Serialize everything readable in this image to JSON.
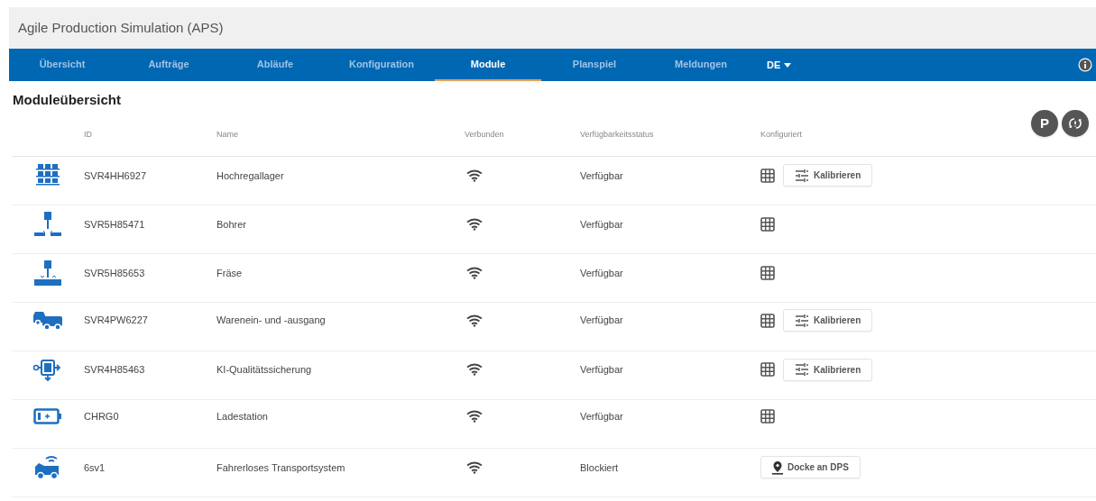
{
  "app_title": "Agile Production Simulation (APS)",
  "tabs": [
    {
      "label": "Übersicht",
      "selected": false
    },
    {
      "label": "Aufträge",
      "selected": false
    },
    {
      "label": "Abläufe",
      "selected": false
    },
    {
      "label": "Konfiguration",
      "selected": false
    },
    {
      "label": "Module",
      "selected": true
    },
    {
      "label": "Planspiel",
      "selected": false
    },
    {
      "label": "Meldungen",
      "selected": false
    }
  ],
  "language": "DE",
  "page_title": "Moduleübersicht",
  "fab_buttons": [
    {
      "kind": "text",
      "label": "P"
    },
    {
      "kind": "sync"
    }
  ],
  "table": {
    "columns": [
      "ID",
      "Name",
      "Verbunden",
      "Verfügbarkeitsstatus",
      "Konfiguriert"
    ],
    "rows": [
      {
        "kind": "rack",
        "id": "SVR4HH6927",
        "name": "Hochregallager",
        "connected": true,
        "status": "Verfügbar",
        "configured": true,
        "action": {
          "kind": "calibrate",
          "label": "Kalibrieren"
        }
      },
      {
        "kind": "drill",
        "id": "SVR5H85471",
        "name": "Bohrer",
        "connected": true,
        "status": "Verfügbar",
        "configured": true
      },
      {
        "kind": "mill",
        "id": "SVR5H85653",
        "name": "Fräse",
        "connected": true,
        "status": "Verfügbar",
        "configured": true
      },
      {
        "kind": "trucks",
        "id": "SVR4PW6227",
        "name": "Warenein- und -ausgang",
        "connected": true,
        "status": "Verfügbar",
        "configured": true,
        "action": {
          "kind": "calibrate",
          "label": "Kalibrieren"
        }
      },
      {
        "kind": "ai",
        "id": "SVR4H85463",
        "name": "KI-Qualitätssicherung",
        "connected": true,
        "status": "Verfügbar",
        "configured": true,
        "action": {
          "kind": "calibrate",
          "label": "Kalibrieren"
        }
      },
      {
        "kind": "battery",
        "id": "CHRG0",
        "name": "Ladestation",
        "connected": true,
        "status": "Verfügbar",
        "configured": true
      },
      {
        "kind": "agv",
        "id": "6sv1",
        "name": "Fahrerloses Transportsystem",
        "connected": true,
        "status": "Blockiert",
        "configured": false,
        "action": {
          "kind": "dock",
          "label": "Docke an DPS"
        }
      }
    ]
  }
}
